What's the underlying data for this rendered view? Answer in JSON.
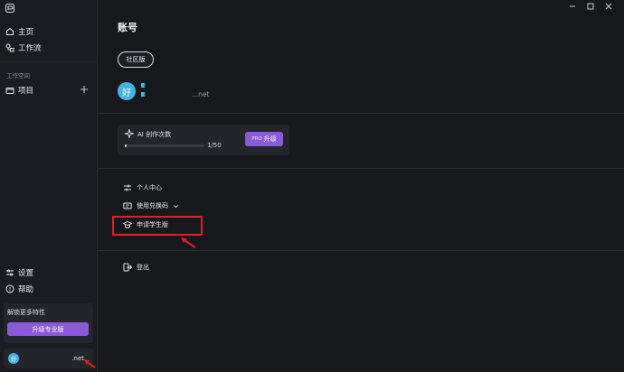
{
  "sidebar": {
    "nav": [
      {
        "label": "主页"
      },
      {
        "label": "工作流"
      }
    ],
    "section_label": "工作空间",
    "projects_label": "项目",
    "bottom_nav": [
      {
        "label": "设置"
      },
      {
        "label": "帮助"
      }
    ],
    "promo": {
      "text": "解锁更多特性",
      "button": "升级专业版"
    },
    "user": {
      "avatar_char": "好",
      "email_tail": ".net"
    }
  },
  "main": {
    "title": "账号",
    "edition": "社区版",
    "profile": {
      "avatar_char": "好",
      "email_tail": "...net"
    },
    "quota": {
      "label": "AI 创作次数",
      "count": "1/50",
      "used_fraction": 0.02,
      "upgrade_tag": "PRO",
      "upgrade_label": "升级"
    },
    "menu": [
      {
        "label": "个人中心"
      },
      {
        "label": "使用兑换码"
      },
      {
        "label": "申请学生版"
      }
    ],
    "logout": "登出"
  },
  "colors": {
    "accent": "#8a5bd6",
    "avatar": "#43b3e6",
    "annotation": "#e02020"
  }
}
